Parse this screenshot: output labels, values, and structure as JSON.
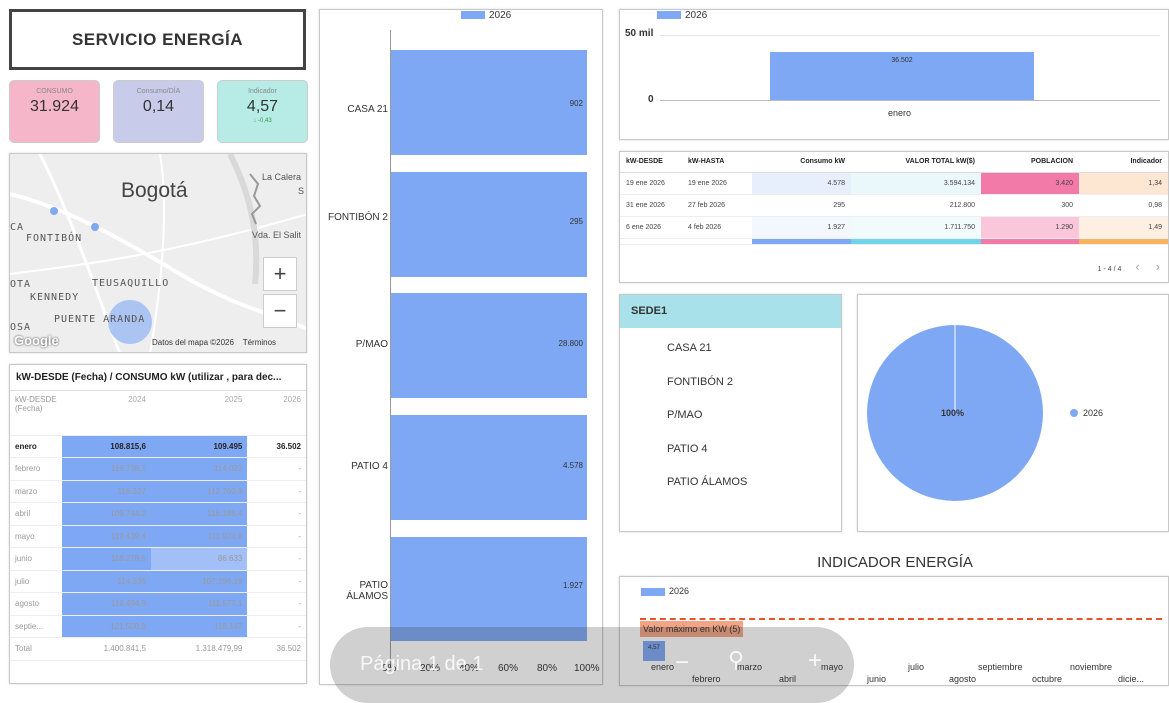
{
  "title": "SERVICIO ENERGÍA",
  "kpis": [
    {
      "label": "CONSUMO",
      "value": "31.924",
      "color": "#f4b6c8"
    },
    {
      "label": "Consumo/DÍA",
      "value": "0,14",
      "color": "#c9cbea"
    },
    {
      "label": "Indicador",
      "value": "4,57",
      "delta": "↓ -0,43",
      "color": "#b7ece6"
    }
  ],
  "map": {
    "labels": {
      "city": "Bogotá",
      "calera": "La Calera",
      "s": "S",
      "salitre": "Vda. El Salit",
      "fontibon": "FONTIBÓN",
      "teusaquillo": "TEUSAQUILLO",
      "kennedy": "KENNEDY",
      "puente": "PUENTE ARANDA",
      "ca": "CA",
      "ota": "OTA",
      "osa": "OSA"
    },
    "zoom_in": "+",
    "zoom_out": "−",
    "logo": "Google",
    "attribution": "Datos del mapa ©2026",
    "terms": "Términos"
  },
  "pivot": {
    "title": "kW-DESDE (Fecha) / CONSUMO kW (utilizar , para dec...",
    "header": [
      "kW-DESDE (Fecha)",
      "2024",
      "2025",
      "2026"
    ],
    "rows": [
      [
        "enero",
        "108.815,6",
        "109.495",
        "36.502"
      ],
      [
        "febrero",
        "116.738,1",
        "114.022",
        "-"
      ],
      [
        "marzo",
        "118.327",
        "112.760,9",
        "-"
      ],
      [
        "abril",
        "109.744,2",
        "116.188,4",
        "-"
      ],
      [
        "mayo",
        "119.439,4",
        "111.924,8",
        "-"
      ],
      [
        "junio",
        "118.278,5",
        "86.633",
        "-"
      ],
      [
        "julio",
        "114.336",
        "107.296,19",
        "-"
      ],
      [
        "agosto",
        "118.494,9",
        "111.577,1",
        "-"
      ],
      [
        "septie...",
        "121.500,9",
        "118.147",
        "-"
      ]
    ],
    "total": [
      "Total",
      "1.400.841,5",
      "1.318.479,99",
      "36.502"
    ]
  },
  "bar_chart": {
    "legend": "2026",
    "x_ticks": [
      "0%",
      "20%",
      "40%",
      "60%",
      "80%",
      "100%"
    ],
    "bars": [
      {
        "label": "CASA 21",
        "value_label": "902"
      },
      {
        "label": "FONTIBÓN 2",
        "value_label": "295"
      },
      {
        "label": "P/MAO",
        "value_label": "28.800"
      },
      {
        "label": "PATIO 4",
        "value_label": "4.578"
      },
      {
        "label": "PATIO ÁLAMOS",
        "value_label": "1.927"
      }
    ]
  },
  "column_chart": {
    "legend": "2026",
    "y_ticks": [
      "50 mil",
      "0"
    ],
    "bar_value": "36.502",
    "x_label": "enero"
  },
  "table": {
    "headers": [
      "kW-DESDE",
      "kW-HASTA",
      "Consumo kW",
      "VALOR TOTAL kW($)",
      "POBLACION",
      "Indicador"
    ],
    "rows": [
      [
        "19 ene 2026",
        "19 ene 2026",
        "4.578",
        "3.594.134",
        "3.420",
        "1,34"
      ],
      [
        "31 ene 2026",
        "27 feb 2026",
        "295",
        "212.800",
        "300",
        "0,98"
      ],
      [
        "6 ene 2026",
        "4 feb 2026",
        "1.927",
        "1.711.750",
        "1.290",
        "1,49"
      ]
    ],
    "pagination": "1 - 4 / 4",
    "prev": "‹",
    "next": "›"
  },
  "sede": {
    "header": "SEDE1",
    "items": [
      "CASA 21",
      "FONTIBÓN 2",
      "P/MAO",
      "PATIO 4",
      "PATIO ÁLAMOS"
    ]
  },
  "pie": {
    "label": "100%",
    "legend": "2026",
    "color": "#7fa8f4"
  },
  "indicator": {
    "title": "INDICADOR ENERGÍA",
    "legend": "2026",
    "max_label": "Valor máximo en KW (5)",
    "bar_value": "4,57",
    "months_top": [
      "enero",
      "marzo",
      "mayo",
      "julio",
      "septiembre",
      "noviembre"
    ],
    "months_bottom": [
      "febrero",
      "abril",
      "junio",
      "agosto",
      "octubre",
      "dicie..."
    ]
  },
  "pager": {
    "text": "Página 1 de 1"
  }
}
